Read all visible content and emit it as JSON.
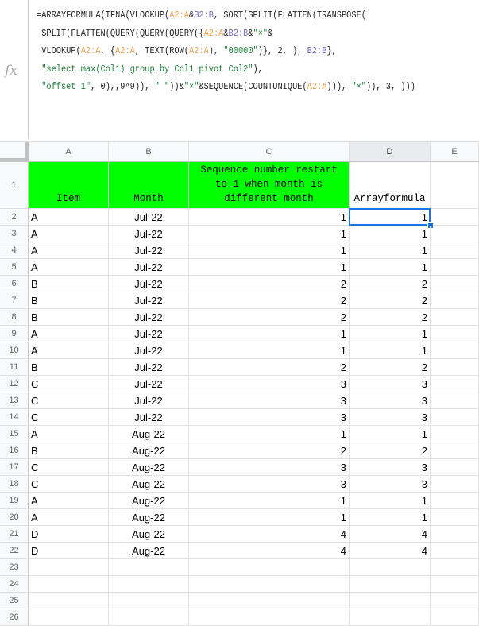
{
  "formula_bar": {
    "icon": "fx-icon",
    "icon_label": "fx",
    "lines": [
      "=ARRAYFORMULA(IFNA(VLOOKUP(A2:A&B2:B, SORT(SPLIT(FLATTEN(TRANSPOSE(",
      " SPLIT(FLATTEN(QUERY(QUERY(QUERY({A2:A&B2:B&\"×\"&",
      " VLOOKUP(A2:A, {A2:A, TEXT(ROW(A2:A), \"00000\")}, 2, ), B2:B},",
      " \"select max(Col1) group by Col1 pivot Col2\"),",
      " \"offset 1\", 0),,9^9)), \" \"))&\"×\"&SEQUENCE(COUNTUNIQUE(A2:A))), \"×\")), 3, )))"
    ]
  },
  "columns": [
    "A",
    "B",
    "C",
    "D",
    "E"
  ],
  "selected_column": "D",
  "selected_cell": "D2",
  "header_row": {
    "row_number": "1",
    "cells": [
      "Item",
      "Month",
      "Sequence number restart to 1 when month is different month",
      "Arrayformula"
    ]
  },
  "colors": {
    "header_fill": "#00ff00",
    "selection": "#1a73e8"
  },
  "rows": [
    {
      "n": "2",
      "item": "A",
      "month": "Jul-22",
      "seq": "1",
      "arr": "1"
    },
    {
      "n": "3",
      "item": "A",
      "month": "Jul-22",
      "seq": "1",
      "arr": "1"
    },
    {
      "n": "4",
      "item": "A",
      "month": "Jul-22",
      "seq": "1",
      "arr": "1"
    },
    {
      "n": "5",
      "item": "A",
      "month": "Jul-22",
      "seq": "1",
      "arr": "1"
    },
    {
      "n": "6",
      "item": "B",
      "month": "Jul-22",
      "seq": "2",
      "arr": "2"
    },
    {
      "n": "7",
      "item": "B",
      "month": "Jul-22",
      "seq": "2",
      "arr": "2"
    },
    {
      "n": "8",
      "item": "B",
      "month": "Jul-22",
      "seq": "2",
      "arr": "2"
    },
    {
      "n": "9",
      "item": "A",
      "month": "Jul-22",
      "seq": "1",
      "arr": "1"
    },
    {
      "n": "10",
      "item": "A",
      "month": "Jul-22",
      "seq": "1",
      "arr": "1"
    },
    {
      "n": "11",
      "item": "B",
      "month": "Jul-22",
      "seq": "2",
      "arr": "2"
    },
    {
      "n": "12",
      "item": "C",
      "month": "Jul-22",
      "seq": "3",
      "arr": "3"
    },
    {
      "n": "13",
      "item": "C",
      "month": "Jul-22",
      "seq": "3",
      "arr": "3"
    },
    {
      "n": "14",
      "item": "C",
      "month": "Jul-22",
      "seq": "3",
      "arr": "3"
    },
    {
      "n": "15",
      "item": "A",
      "month": "Aug-22",
      "seq": "1",
      "arr": "1"
    },
    {
      "n": "16",
      "item": "B",
      "month": "Aug-22",
      "seq": "2",
      "arr": "2"
    },
    {
      "n": "17",
      "item": "C",
      "month": "Aug-22",
      "seq": "3",
      "arr": "3"
    },
    {
      "n": "18",
      "item": "C",
      "month": "Aug-22",
      "seq": "3",
      "arr": "3"
    },
    {
      "n": "19",
      "item": "A",
      "month": "Aug-22",
      "seq": "1",
      "arr": "1"
    },
    {
      "n": "20",
      "item": "A",
      "month": "Aug-22",
      "seq": "1",
      "arr": "1"
    },
    {
      "n": "21",
      "item": "D",
      "month": "Aug-22",
      "seq": "4",
      "arr": "4"
    },
    {
      "n": "22",
      "item": "D",
      "month": "Aug-22",
      "seq": "4",
      "arr": "4"
    },
    {
      "n": "23",
      "item": "",
      "month": "",
      "seq": "",
      "arr": ""
    },
    {
      "n": "24",
      "item": "",
      "month": "",
      "seq": "",
      "arr": ""
    },
    {
      "n": "25",
      "item": "",
      "month": "",
      "seq": "",
      "arr": ""
    },
    {
      "n": "26",
      "item": "",
      "month": "",
      "seq": "",
      "arr": ""
    }
  ]
}
